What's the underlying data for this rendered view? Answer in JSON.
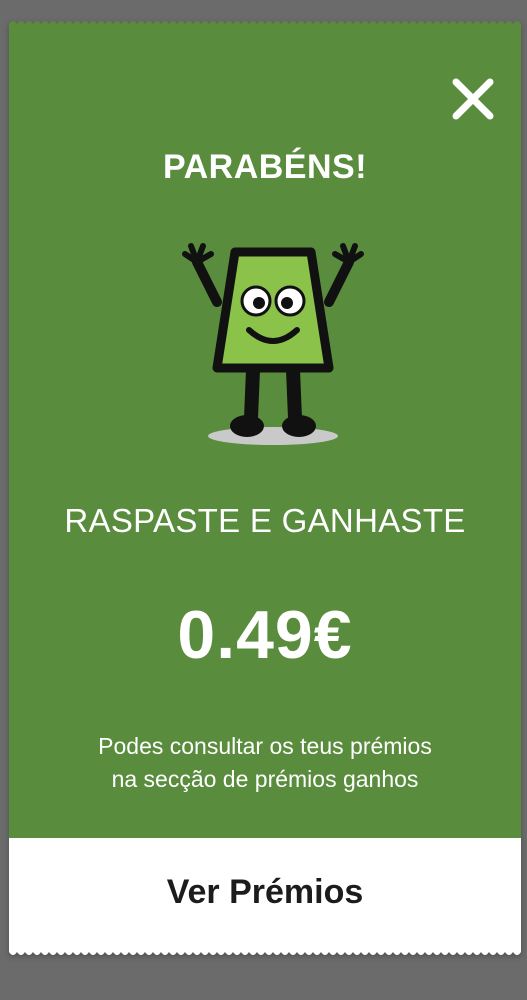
{
  "modal": {
    "title": "PARABÉNS!",
    "subtitle": "RASPASTE E GANHASTE",
    "amount": "0.49€",
    "info_line1": "Podes consultar os teus prémios",
    "info_line2": "na secção de prémios ganhos",
    "cta_label": "Ver Prémios",
    "close_icon": "close-icon",
    "mascot_icon": "mascot-icon"
  },
  "colors": {
    "ticket_green": "#5a8c3d",
    "mascot_green": "#8bc34a",
    "cta_background": "#ffffff",
    "cta_text": "#1c1c1c",
    "backdrop": "#6b6b6b"
  }
}
